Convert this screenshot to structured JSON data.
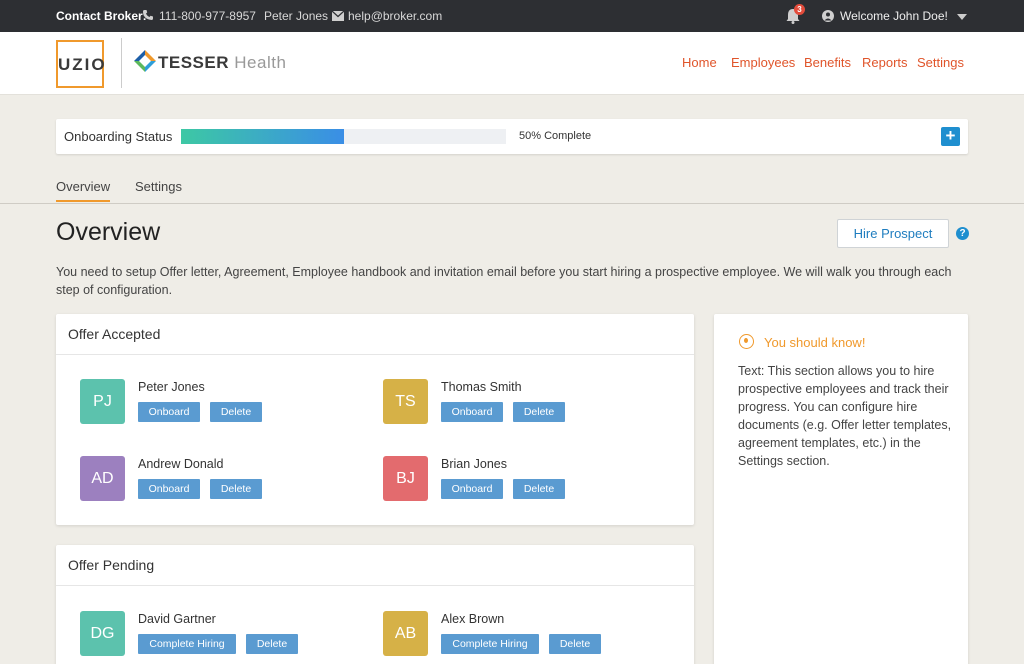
{
  "topbar": {
    "contact_label": "Contact Broker:",
    "phone": "111-800-977-8957",
    "broker_name": "Peter Jones",
    "email": "help@broker.com",
    "notifications_count": "3",
    "welcome": "Welcome John Doe!"
  },
  "header": {
    "uzio_logo": "UZIO",
    "tesser_brand": "TESSER",
    "tesser_suffix": "Health",
    "nav": [
      "Home",
      "Employees",
      "Benefits",
      "Reports",
      "Settings"
    ]
  },
  "status": {
    "label": "Onboarding Status",
    "progress_fraction": 0.5,
    "progress_text": "50% Complete",
    "add_label": "+"
  },
  "tabs": [
    "Overview",
    "Settings"
  ],
  "overview": {
    "title": "Overview",
    "hire_button": "Hire Prospect",
    "help": "?",
    "intro": "You need to setup Offer letter, Agreement, Employee handbook and invitation email before you start hiring a prospective employee. We will walk you through each step of configuration."
  },
  "offer_accepted": {
    "title": "Offer Accepted",
    "people": [
      {
        "initials": "PJ",
        "name": "Peter Jones",
        "color": "#5cc2ad",
        "primary": "Onboard",
        "secondary": "Delete"
      },
      {
        "initials": "TS",
        "name": "Thomas Smith",
        "color": "#d6b147",
        "primary": "Onboard",
        "secondary": "Delete"
      },
      {
        "initials": "AD",
        "name": "Andrew Donald",
        "color": "#9c80bf",
        "primary": "Onboard",
        "secondary": "Delete"
      },
      {
        "initials": "BJ",
        "name": "Brian Jones",
        "color": "#e36b6e",
        "primary": "Onboard",
        "secondary": "Delete"
      }
    ]
  },
  "offer_pending": {
    "title": "Offer Pending",
    "people": [
      {
        "initials": "DG",
        "name": "David Gartner",
        "color": "#5cc2ad",
        "primary": "Complete Hiring",
        "secondary": "Delete"
      },
      {
        "initials": "AB",
        "name": "Alex Brown",
        "color": "#d6b147",
        "primary": "Complete Hiring",
        "secondary": "Delete"
      }
    ]
  },
  "info": {
    "title": "You should know!",
    "text": "Text: This section allows you to hire prospective employees and track their progress. You can configure hire documents (e.g. Offer letter templates, agreement templates, etc.) in the Settings section."
  }
}
